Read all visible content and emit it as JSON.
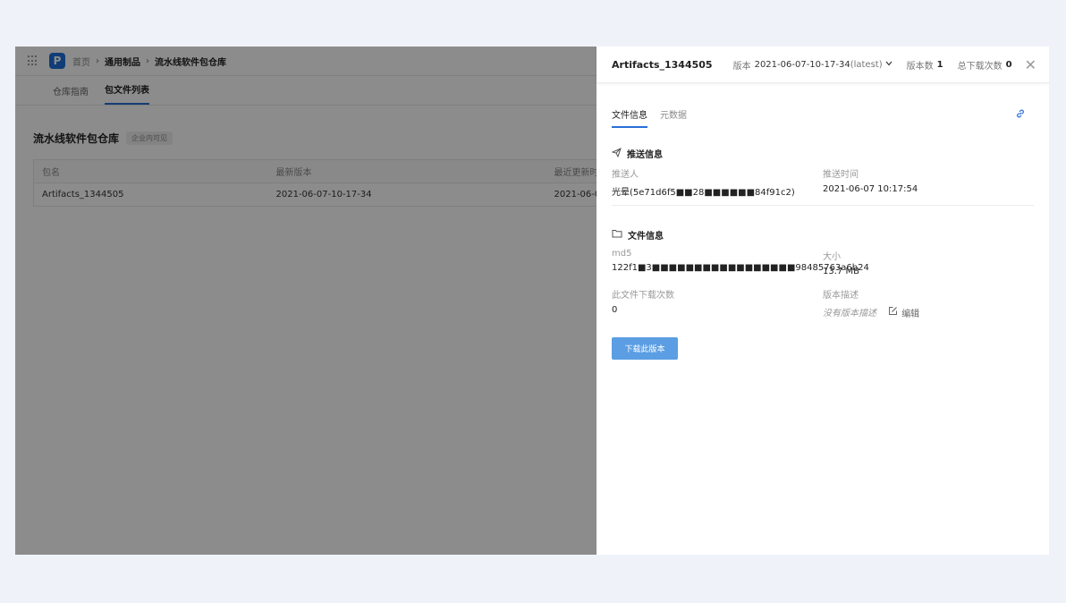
{
  "breadcrumb": {
    "home": "首页",
    "category": "通用制品",
    "repo": "流水线软件包仓库"
  },
  "tabs": [
    {
      "label": "仓库指南"
    },
    {
      "label": "包文件列表"
    }
  ],
  "repo": {
    "title": "流水线软件包仓库",
    "visibility": "企业内可见"
  },
  "table": {
    "headers": [
      "包名",
      "最新版本",
      "最近更新时"
    ],
    "rows": [
      {
        "name": "Artifacts_1344505",
        "version": "2021-06-07-10-17-34",
        "updated": "2021-06-0"
      }
    ]
  },
  "drawer": {
    "name": "Artifacts_1344505",
    "version_label": "版本",
    "version_value": "2021-06-07-10-17-34",
    "version_tag": "(latest)",
    "count_label": "版本数",
    "count_value": "1",
    "downloads_label": "总下载次数",
    "downloads_value": "0",
    "close": "✕",
    "tabs": [
      {
        "label": "文件信息"
      },
      {
        "label": "元数据"
      }
    ],
    "push": {
      "title": "推送信息",
      "pusher_label": "推送人",
      "pusher_value": "光晕(5e71d6f5■■28■■■■■■84f91c2)",
      "time_label": "推送时间",
      "time_value": "2021-06-07 10:17:54"
    },
    "file": {
      "title": "文件信息",
      "md5_label": "md5",
      "md5_value": "122f1■3■■■■■■■■■■■■■■■■■98485763a6b24",
      "size_label": "大小",
      "size_value": "13.7 MB",
      "dl_label": "此文件下载次数",
      "dl_value": "0",
      "desc_label": "版本描述",
      "desc_value": "没有版本描述",
      "edit_label": "编辑"
    },
    "download_button": "下载此版本"
  },
  "colors": {
    "accent": "#2b6fd6",
    "button": "#5b9ee3",
    "logo": "#1e6fd9",
    "page_bg": "#eff3f9"
  }
}
